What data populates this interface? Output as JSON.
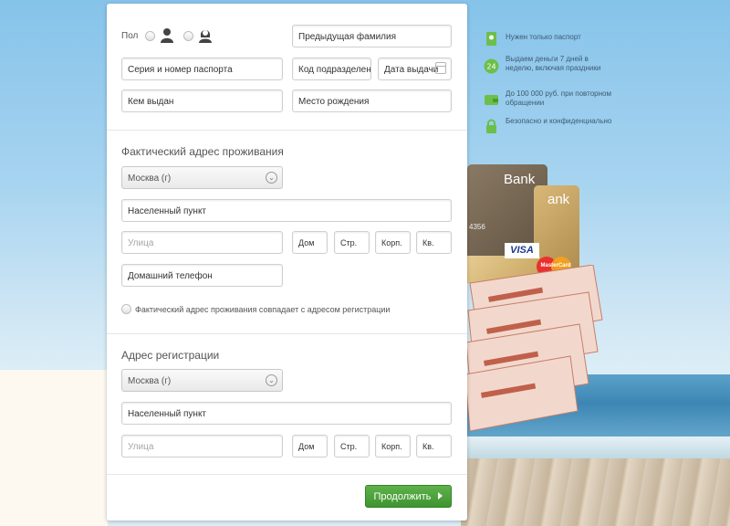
{
  "form": {
    "gender_label": "Пол",
    "prev_surname_placeholder": "Предыдущая фамилия",
    "passport_placeholder": "Серия и номер паспорта",
    "division_code_placeholder": "Код подразделения",
    "issue_date_placeholder": "Дата выдачи",
    "issued_by_placeholder": "Кем выдан",
    "birthplace_placeholder": "Место рождения",
    "actual": {
      "title": "Фактический адрес проживания",
      "city_value": "Москва (г)",
      "locality_placeholder": "Населенный пункт",
      "street_placeholder": "Улица",
      "house_placeholder": "Дом",
      "building_placeholder": "Стр.",
      "block_placeholder": "Корп.",
      "apt_placeholder": "Кв.",
      "phone_placeholder": "Домашний телефон",
      "same_address_label": "Фактический адрес проживания совпадает с адресом регистрации"
    },
    "registration": {
      "title": "Адрес регистрации",
      "city_value": "Москва (г)",
      "locality_placeholder": "Населенный пункт",
      "street_placeholder": "Улица",
      "house_placeholder": "Дом",
      "building_placeholder": "Стр.",
      "block_placeholder": "Корп.",
      "apt_placeholder": "Кв."
    },
    "continue_label": "Продолжить"
  },
  "features": [
    {
      "icon": "passport-icon",
      "text": "Нужен только паспорт"
    },
    {
      "icon": "24-hours-icon",
      "text": "Выдаем деньги 7 дней в неделю, включая праздники"
    },
    {
      "icon": "wallet-icon",
      "text": "До 100 000 руб. при повторном обращении"
    },
    {
      "icon": "lock-icon",
      "text": "Безопасно и конфиденциально"
    }
  ],
  "cards": {
    "bank_label_1": "Bank",
    "bank_label_2": "ank",
    "card_number_fragment": "4356",
    "visa_label": "VISA",
    "mastercard_label": "MasterCard"
  },
  "colors": {
    "accent_green": "#4aa33a",
    "feature_icon_green": "#6cbf4b"
  }
}
